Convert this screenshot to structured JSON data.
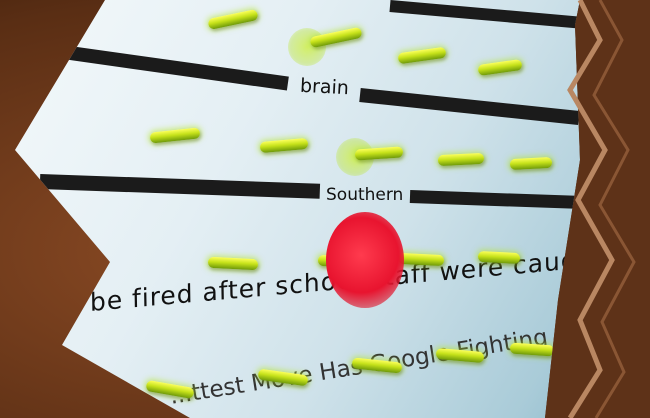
{
  "words": {
    "brain": "brain",
    "southern": "Southern",
    "line1": "be fired after school staff were caught bullying s",
    "line2": "...ttest Move Has Google Fighting on Two Fro"
  },
  "colors": {
    "screen_light": "#eef6f8",
    "screen_blue": "#8fbccc",
    "bar": "#1b1b1b",
    "peg_green": "#c6e21a",
    "indicator_red": "#e8142f",
    "frame_brown": "#6a3a1c"
  }
}
